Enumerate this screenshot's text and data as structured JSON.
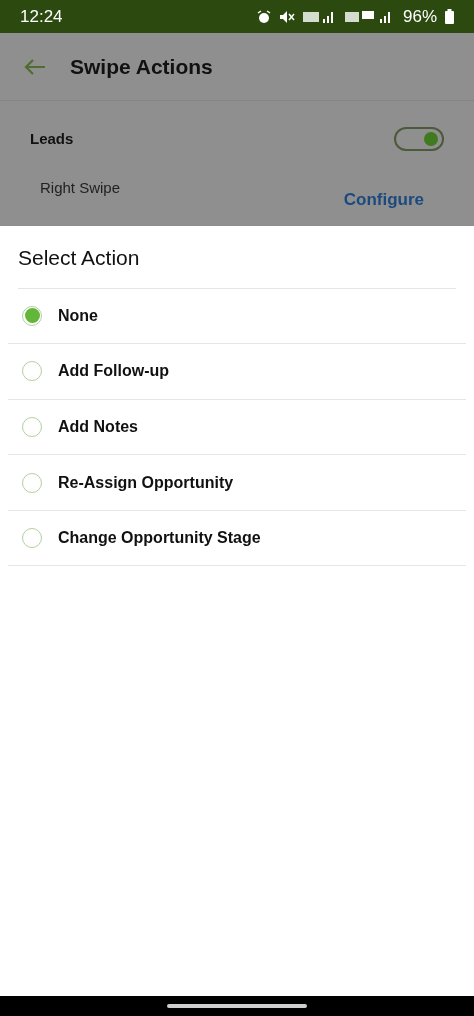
{
  "status_bar": {
    "time": "12:24",
    "battery": "96%"
  },
  "app_bar": {
    "title": "Swipe Actions"
  },
  "section": {
    "title": "Leads",
    "toggle_on": true
  },
  "setting": {
    "label": "Right Swipe",
    "action": "Configure"
  },
  "sheet": {
    "title": "Select Action",
    "options": [
      {
        "label": "None",
        "selected": true
      },
      {
        "label": "Add Follow-up",
        "selected": false
      },
      {
        "label": "Add Notes",
        "selected": false
      },
      {
        "label": "Re-Assign Opportunity",
        "selected": false
      },
      {
        "label": "Change Opportunity Stage",
        "selected": false
      }
    ]
  }
}
